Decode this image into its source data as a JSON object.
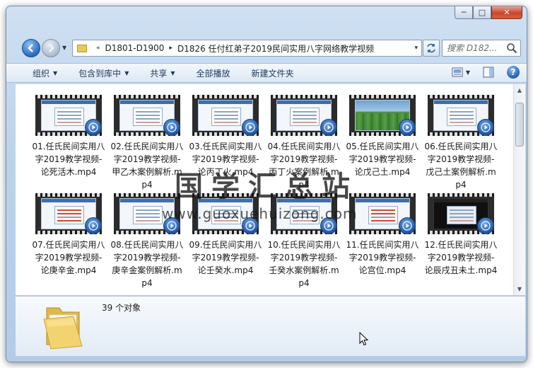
{
  "window": {
    "controls": {
      "minimize": "─",
      "maximize": "□",
      "close": "✕"
    }
  },
  "address": {
    "history_marker": "«",
    "crumbs": [
      "D1801-D1900",
      "D1826 任付红弟子2019民间实用八字网络教学视频"
    ],
    "separator": "▸",
    "dropdown": "▾"
  },
  "search": {
    "placeholder": "搜索 D182..."
  },
  "toolbar": {
    "organize": "组织",
    "include_in_library": "包含到库中",
    "share": "共享",
    "play_all": "全部播放",
    "new_folder": "新建文件夹"
  },
  "files": [
    {
      "name": "01.任氏民间实用八字2019教学视频-论死活木.mp4",
      "thumb": "screen"
    },
    {
      "name": "02.任氏民间实用八字2019教学视频-甲乙木案例解析.mp4",
      "thumb": "screen"
    },
    {
      "name": "03.任氏民间实用八字2019教学视频-论丙丁火.mp4",
      "thumb": "screen"
    },
    {
      "name": "04.任氏民间实用八字2019教学视频-丙丁火案例解析.mp4",
      "thumb": "screen"
    },
    {
      "name": "05.任氏民间实用八字2019教学视频-论戊己土.mp4",
      "thumb": "green"
    },
    {
      "name": "06.任氏民间实用八字2019教学视频-戊己土案例解析.mp4",
      "thumb": "screen"
    },
    {
      "name": "07.任氏民间实用八字2019教学视频-论庚辛金.mp4",
      "thumb": "red"
    },
    {
      "name": "08.任氏民间实用八字2019教学视频-庚辛金案例解析.mp4",
      "thumb": "screen"
    },
    {
      "name": "09.任氏民间实用八字2019教学视频-论壬癸水.mp4",
      "thumb": "screen"
    },
    {
      "name": "10.任氏民间实用八字2019教学视频-壬癸水案例解析.mp4",
      "thumb": "screen"
    },
    {
      "name": "11.任氏民间实用八字2019教学视频-论宫位.mp4",
      "thumb": "red"
    },
    {
      "name": "12.任氏民间实用八字2019教学视频-论辰戌丑未土.mp4",
      "thumb": "dark"
    }
  ],
  "watermark": {
    "title": "国学汇总站",
    "url": "www.guoxuehuizong.com"
  },
  "details": {
    "count": "39 个对象"
  }
}
